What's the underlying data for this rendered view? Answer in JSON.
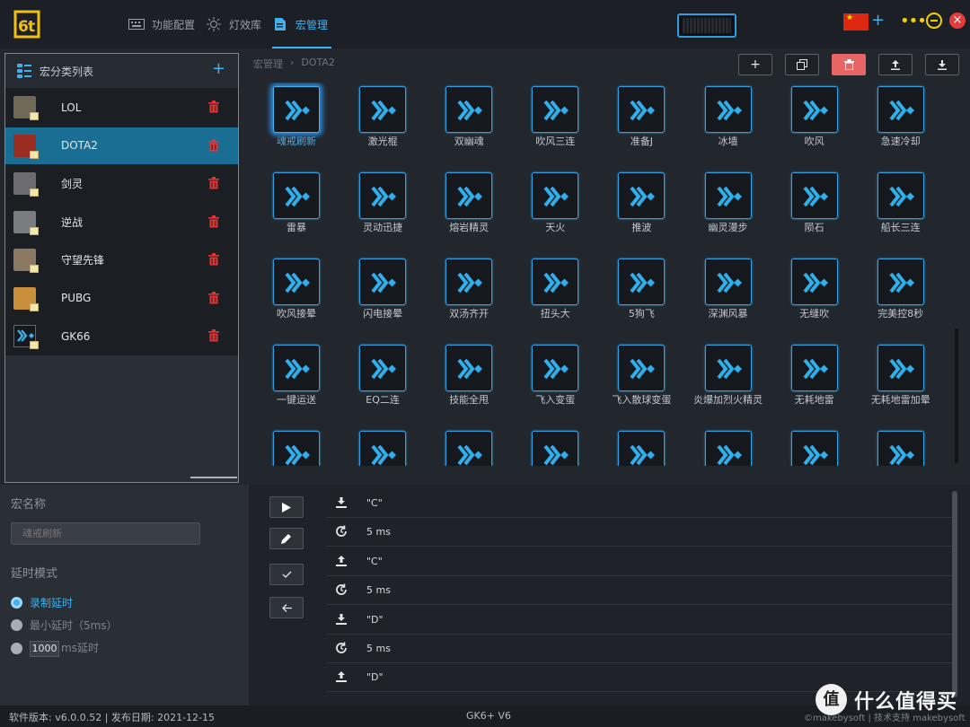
{
  "tabs": [
    {
      "label": "功能配置",
      "icon": "keyboard-icon"
    },
    {
      "label": "灯效库",
      "icon": "light-icon"
    },
    {
      "label": "宏管理",
      "icon": "document-icon",
      "active": true
    }
  ],
  "macro_category_panel": {
    "title": "宏分类列表",
    "items": [
      {
        "label": "LOL",
        "thumb": "#6f6a55"
      },
      {
        "label": "DOTA2",
        "thumb": "#9a2d22",
        "selected": true
      },
      {
        "label": "剑灵",
        "thumb": "#6b6b70"
      },
      {
        "label": "逆战",
        "thumb": "#7a7c80"
      },
      {
        "label": "守望先锋",
        "thumb": "#8a7860"
      },
      {
        "label": "PUBG",
        "thumb": "#c98f3a"
      },
      {
        "label": "GK66",
        "thumb": "#15181c"
      }
    ]
  },
  "breadcrumb": [
    "宏管理",
    "DOTA2"
  ],
  "toolbar": {
    "add": "+",
    "copy": "copy-icon",
    "delete": "trash-icon",
    "import": "upload-icon",
    "export": "download-icon"
  },
  "macros": [
    "魂戒刷新",
    "激光棍",
    "双幽魂",
    "吹风三连",
    "准备J",
    "冰墙",
    "吹风",
    "急速冷却",
    "雷暴",
    "灵动迅捷",
    "熔岩精灵",
    "天火",
    "推波",
    "幽灵漫步",
    "陨石",
    "船长三连",
    "吹风接晕",
    "闪电接晕",
    "双汤齐开",
    "扭头大",
    "5狗飞",
    "深渊风暴",
    "无缝吹",
    "完美控8秒",
    "一键运送",
    "EQ二连",
    "技能全甩",
    "飞入变蛋",
    "飞入散球变蛋",
    "炎爆加烈火精灵",
    "无耗地雷",
    "无耗地雷加晕",
    "",
    "",
    "",
    "",
    "",
    "",
    "",
    ""
  ],
  "selected_macro": 0,
  "editor": {
    "name_label": "宏名称",
    "name_placeholder": "魂戒刷新",
    "delay_label": "延时模式",
    "delay_options": [
      "录制延时",
      "最小延时（5ms）",
      "ms延时"
    ],
    "delay_value": "1000",
    "selected_delay": 0
  },
  "action_buttons": [
    "play-icon",
    "edit-icon",
    "check-icon",
    "back-icon"
  ],
  "steps": [
    {
      "type": "down",
      "value": "\"C\""
    },
    {
      "type": "delay",
      "value": "5 ms"
    },
    {
      "type": "up",
      "value": "\"C\""
    },
    {
      "type": "delay",
      "value": "5 ms"
    },
    {
      "type": "down",
      "value": "\"D\""
    },
    {
      "type": "delay",
      "value": "5 ms"
    },
    {
      "type": "up",
      "value": "\"D\""
    }
  ],
  "status": {
    "version": "软件版本: v6.0.0.52 | 发布日期: 2021-12-15",
    "model": "GK6+ V6",
    "credit": "©makebysoft | 技术支持 makebysoft"
  },
  "watermark": {
    "circle": "值",
    "text": "什么值得买"
  }
}
